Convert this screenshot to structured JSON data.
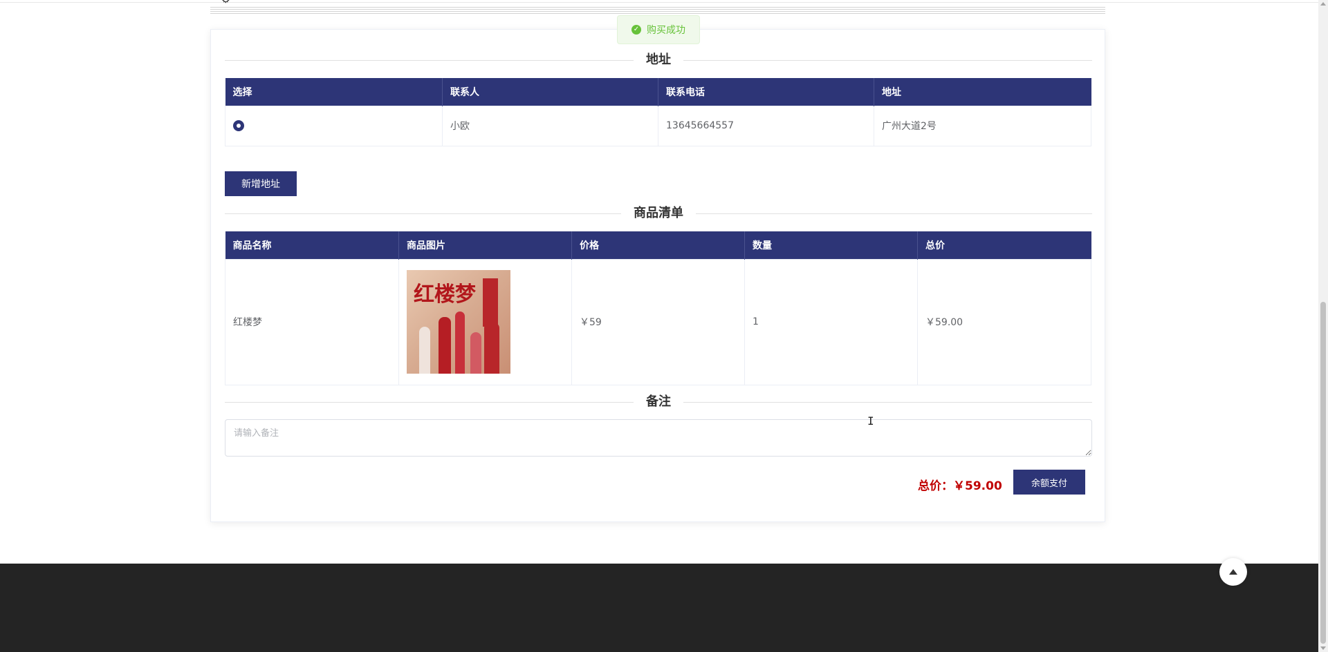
{
  "toast": {
    "message": "购买成功"
  },
  "address_section": {
    "title": "地址",
    "columns": [
      "选择",
      "联系人",
      "联系电话",
      "地址"
    ],
    "rows": [
      {
        "selected": true,
        "contact": "小欧",
        "phone": "13645664557",
        "address": "广州大道2号"
      }
    ],
    "add_button": "新增地址"
  },
  "goods_section": {
    "title": "商品清单",
    "columns": [
      "商品名称",
      "商品图片",
      "价格",
      "数量",
      "总价"
    ],
    "rows": [
      {
        "name": "红楼梦",
        "image_text": "红楼梦",
        "price": "￥59",
        "quantity": "1",
        "subtotal": "￥59.00"
      }
    ]
  },
  "remark_section": {
    "title": "备注",
    "placeholder": "请输入备注",
    "value": ""
  },
  "summary": {
    "total_label": "总价：",
    "total_value": "￥59.00",
    "pay_button": "余额支付"
  },
  "colors": {
    "primary": "#2d3577",
    "total": "#c00000",
    "success": "#67c23a",
    "footer": "#242424"
  },
  "icons": [
    "gear-icon",
    "check-circle-icon",
    "radio-checked-icon",
    "arrow-up-icon"
  ]
}
